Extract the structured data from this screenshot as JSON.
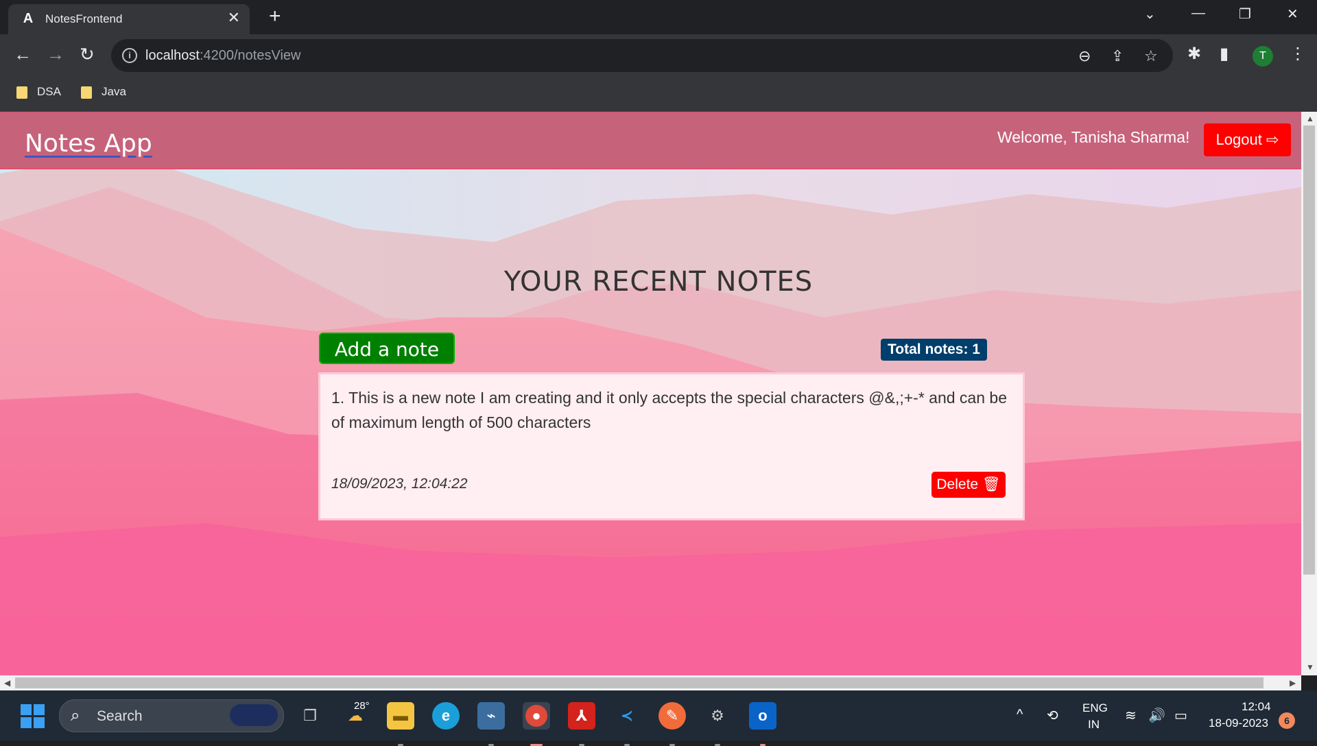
{
  "browser": {
    "tab_title": "NotesFrontend",
    "tab_favicon": "A",
    "new_tab_glyph": "+",
    "url_host": "localhost",
    "url_path": ":4200/notesView",
    "profile_initial": "T",
    "bookmarks": [
      {
        "label": "DSA",
        "icon": "folder-icon"
      },
      {
        "label": "Java",
        "icon": "folder-icon"
      }
    ]
  },
  "app": {
    "brand": "Notes App",
    "welcome": "Welcome, Tanisha Sharma!",
    "logout_label": "Logout",
    "heading": "YOUR RECENT NOTES",
    "add_note_label": "Add a note +",
    "total_notes_label": "Total notes: 1",
    "notes": [
      {
        "text": "1. This is a new note I am creating and it only accepts the special characters @&,;+-* and can be of maximum length of 500 characters",
        "timestamp": "18/09/2023, 12:04:22",
        "delete_label": "Delete"
      }
    ],
    "colors": {
      "navbar": "#c7627b",
      "logout": "#ff0000",
      "add": "#008000",
      "badge": "#003e6b"
    }
  },
  "taskbar": {
    "search_placeholder": "Search",
    "weather_temp": "28°",
    "lang_top": "ENG",
    "lang_bottom": "IN",
    "time": "12:04",
    "date": "18-09-2023",
    "notification_count": "6"
  }
}
